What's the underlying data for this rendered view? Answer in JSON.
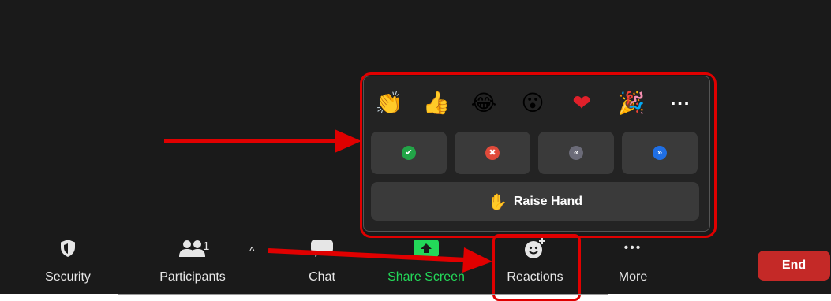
{
  "toolbar": {
    "security_label": "Security",
    "participants_label": "Participants",
    "participants_count": "1",
    "caret": "^",
    "chat_label": "Chat",
    "share_label": "Share Screen",
    "reactions_label": "Reactions",
    "more_label": "More",
    "more_icon": "•••",
    "end_label": "End"
  },
  "reactions": {
    "emojis": [
      "👏",
      "👍",
      "😂",
      "😮",
      "❤",
      "🎉"
    ],
    "more_glyph": "···",
    "feedback": [
      {
        "name": "yes",
        "glyph": "✔",
        "color": "#22a447"
      },
      {
        "name": "no",
        "glyph": "✖",
        "color": "#e04a3a"
      },
      {
        "name": "go-slower",
        "glyph": "«",
        "color": "#6b6b78"
      },
      {
        "name": "go-faster",
        "glyph": "»",
        "color": "#1f6fe5"
      }
    ],
    "raise_hand_icon": "✋",
    "raise_hand_label": "Raise Hand"
  },
  "colors": {
    "annotation_red": "#e00000",
    "share_green": "#23d959",
    "end_red": "#c42927"
  },
  "icons": {
    "security": "shield-icon",
    "participants": "people-icon",
    "chat": "speech-bubble-icon",
    "share": "share-screen-icon",
    "reactions": "smiley-plus-icon",
    "more": "ellipsis-icon"
  }
}
